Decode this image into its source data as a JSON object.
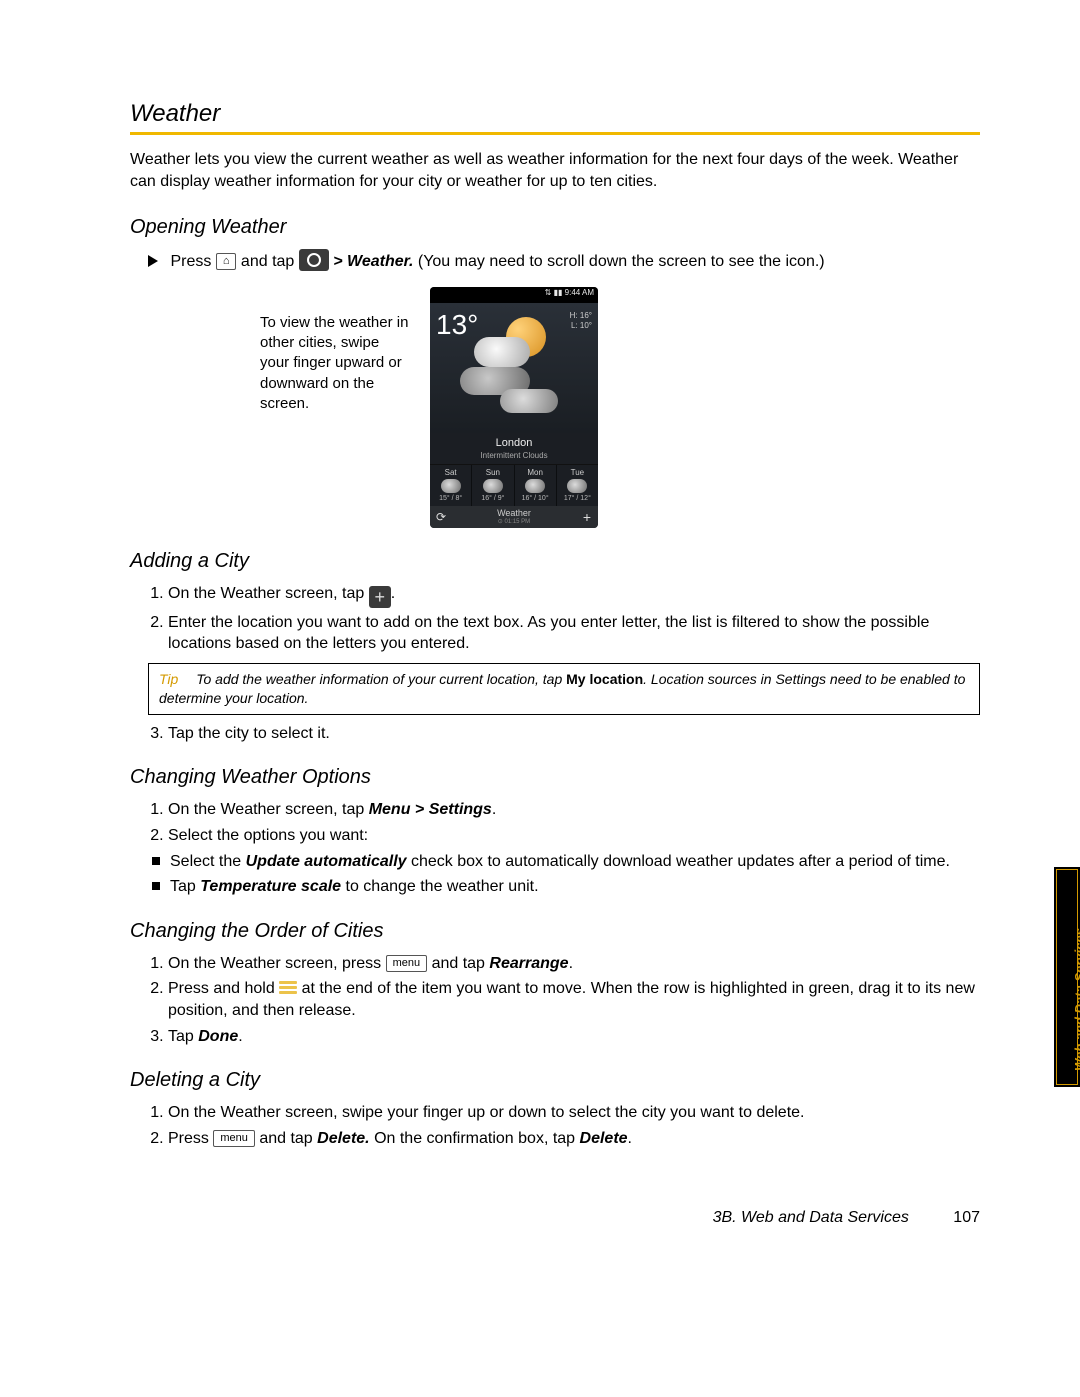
{
  "title": "Weather",
  "intro": "Weather lets you view the current weather as well as weather information for the next four days of the week. Weather can display weather information for your city or weather for up to ten cities.",
  "opening": {
    "heading": "Opening Weather",
    "press": "Press",
    "home_key": "⌂",
    "and_tap": "and tap",
    "gt": ">",
    "weather_label": "Weather.",
    "note": "(You may need to scroll down the screen to see the icon.)",
    "tip_text": "To view the weather in other cities, swipe your finger upward or downward on the screen."
  },
  "phone": {
    "status_time": "9:44 AM",
    "temp": "13°",
    "hi": "H: 16°",
    "lo": "L: 10°",
    "city": "London",
    "cond": "Intermittent Clouds",
    "days": [
      {
        "d": "Sat",
        "t": "15° / 8°"
      },
      {
        "d": "Sun",
        "t": "16° / 9°"
      },
      {
        "d": "Mon",
        "t": "16° / 10°"
      },
      {
        "d": "Tue",
        "t": "17° / 12°"
      }
    ],
    "bottom_label": "Weather",
    "bottom_sub": "⊙ 01:15 PM"
  },
  "adding": {
    "heading": "Adding a City",
    "step1_a": "On the Weather screen, tap",
    "step1_b": ".",
    "step2": "Enter the location you want to add on the text box. As you enter letter, the list is filtered to show the possible locations based on the letters you entered.",
    "tip_label": "Tip",
    "tip_a": "To add the weather information of your current location, tap ",
    "tip_bold": "My location",
    "tip_b": ". Location sources in Settings need to be enabled to determine your location.",
    "step3": "Tap the city to select it."
  },
  "options": {
    "heading": "Changing Weather Options",
    "step1_a": "On the Weather screen, tap ",
    "step1_menu": "Menu > Settings",
    "step1_b": ".",
    "step2": "Select the options you want:",
    "b1_a": "Select the ",
    "b1_bold": "Update automatically",
    "b1_b": " check box to automatically download weather updates after a period of time.",
    "b2_a": "Tap ",
    "b2_bold": "Temperature scale",
    "b2_b": " to change the weather unit."
  },
  "order": {
    "heading": "Changing the Order of Cities",
    "step1_a": "On the Weather screen, press ",
    "menu_key": "menu",
    "step1_b": " and tap ",
    "step1_bold": "Rearrange",
    "step1_c": ".",
    "step2_a": "Press and hold ",
    "step2_b": " at the end of the item you want to move. When the row is highlighted in green, drag it to its new position, and then release.",
    "step3_a": "Tap ",
    "step3_bold": "Done",
    "step3_b": "."
  },
  "deleting": {
    "heading": "Deleting a City",
    "step1": "On the Weather screen, swipe your finger up or down to select the city you want to delete.",
    "step2_a": "Press ",
    "menu_key": "menu",
    "step2_b": " and tap ",
    "step2_bold1": "Delete.",
    "step2_c": " On the confirmation box, tap ",
    "step2_bold2": "Delete",
    "step2_d": "."
  },
  "side_tab": "Web and Data Services",
  "footer": {
    "section": "3B. Web and Data Services",
    "page": "107"
  }
}
